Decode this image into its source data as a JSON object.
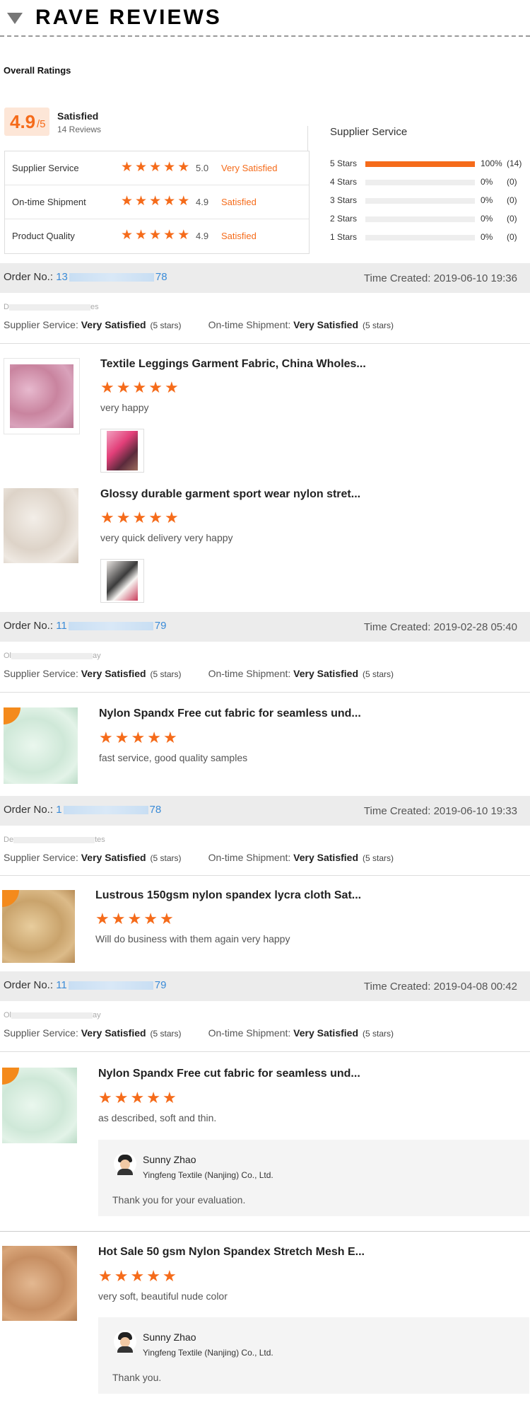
{
  "header": {
    "title": "RAVE REVIEWS"
  },
  "overall": {
    "label": "Overall Ratings",
    "score": "4.9",
    "score_suffix": "/5",
    "summary": "Satisfied",
    "review_count": "14 Reviews",
    "categories": [
      {
        "name": "Supplier Service",
        "value": "5.0",
        "text": "Very Satisfied",
        "stars": 5
      },
      {
        "name": "On-time Shipment",
        "value": "4.9",
        "text": "Satisfied",
        "stars": 5
      },
      {
        "name": "Product Quality",
        "value": "4.9",
        "text": "Satisfied",
        "stars": 5
      }
    ]
  },
  "distribution": {
    "title": "Supplier Service",
    "rows": [
      {
        "label": "5 Stars",
        "percent": "100%",
        "count": "(14)",
        "fill": 1.0
      },
      {
        "label": "4 Stars",
        "percent": "0%",
        "count": "(0)",
        "fill": 0
      },
      {
        "label": "3 Stars",
        "percent": "0%",
        "count": "(0)",
        "fill": 0
      },
      {
        "label": "2 Stars",
        "percent": "0%",
        "count": "(0)",
        "fill": 0
      },
      {
        "label": "1 Stars",
        "percent": "0%",
        "count": "(0)",
        "fill": 0
      }
    ]
  },
  "labels": {
    "order_no": "Order No.:",
    "time_created": "Time Created:",
    "supplier_service": "Supplier Service:",
    "ontime_shipment": "On-time Shipment:"
  },
  "orders": [
    {
      "order_prefix": "13",
      "order_suffix": "78",
      "time": "2019-06-10 19:36",
      "buyer_start": "D",
      "buyer_end": "es",
      "supplier_rating": "Very Satisfied",
      "supplier_stars": "(5 stars)",
      "shipment_rating": "Very Satisfied",
      "shipment_stars": "(5 stars)",
      "items": [
        {
          "title": "Textile Leggings Garment Fabric, China Wholes...",
          "review": "very happy",
          "stars": 5
        },
        {
          "title": "Glossy durable garment sport wear nylon stret...",
          "review": "very quick delivery very happy",
          "stars": 5
        }
      ]
    },
    {
      "order_prefix": "11",
      "order_suffix": "79",
      "time": "2019-02-28 05:40",
      "buyer_start": "Ol",
      "buyer_end": "ay",
      "supplier_rating": "Very Satisfied",
      "supplier_stars": "(5 stars)",
      "shipment_rating": "Very Satisfied",
      "shipment_stars": "(5 stars)",
      "items": [
        {
          "title": "Nylon Spandx Free cut fabric for seamless und...",
          "review": "fast service, good quality samples",
          "stars": 5
        }
      ]
    },
    {
      "order_prefix": "1",
      "order_suffix": "78",
      "time": "2019-06-10 19:33",
      "buyer_start": "De",
      "buyer_end": "tes",
      "supplier_rating": "Very Satisfied",
      "supplier_stars": "(5 stars)",
      "shipment_rating": "Very Satisfied",
      "shipment_stars": "(5 stars)",
      "items": [
        {
          "title": "Lustrous 150gsm nylon spandex lycra cloth Sat...",
          "review": "Will do business with them again very happy",
          "stars": 5
        }
      ]
    },
    {
      "order_prefix": "11",
      "order_suffix": "79",
      "time": "2019-04-08 00:42",
      "buyer_start": "Ol",
      "buyer_end": "ay",
      "supplier_rating": "Very Satisfied",
      "supplier_stars": "(5 stars)",
      "shipment_rating": "Very Satisfied",
      "shipment_stars": "(5 stars)",
      "items": [
        {
          "title": "Nylon Spandx Free cut fabric for seamless und...",
          "review": "as described, soft and thin.",
          "stars": 5,
          "reply": {
            "name": "Sunny Zhao",
            "company": "Yingfeng Textile (Nanjing) Co., Ltd.",
            "message": "Thank you for your evaluation."
          }
        },
        {
          "title": "Hot Sale 50 gsm Nylon Spandex Stretch Mesh E...",
          "review": "very soft, beautiful nude color",
          "stars": 5,
          "reply": {
            "name": "Sunny Zhao",
            "company": "Yingfeng Textile (Nanjing) Co., Ltd.",
            "message": "Thank you."
          }
        }
      ]
    }
  ],
  "colors": {
    "accent": "#f56b1a",
    "link": "#3a8bd8",
    "order_bar": "#ececec"
  },
  "icons": {
    "collapse": "triangle-down-icon",
    "star": "star-icon",
    "avatar": "avatar-icon"
  }
}
